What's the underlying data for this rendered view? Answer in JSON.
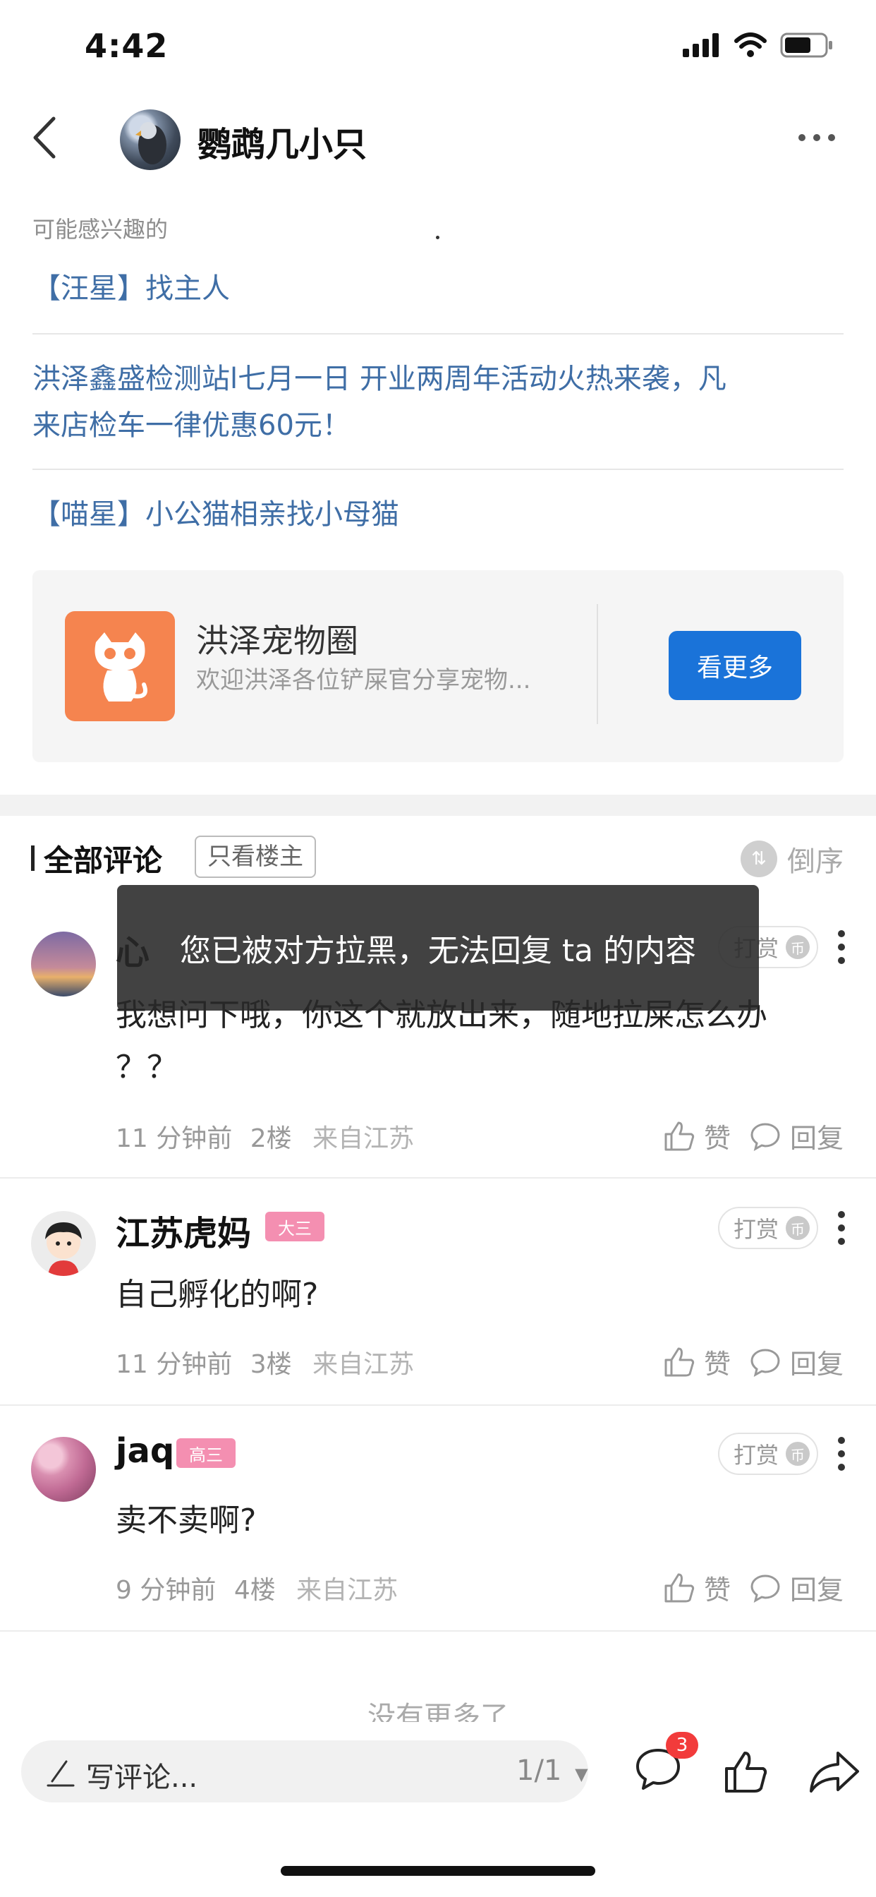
{
  "status_bar": {
    "time": "4:42"
  },
  "nav": {
    "title": "鹦鹉几小只"
  },
  "related": {
    "section_label": "可能感兴趣的",
    "items": [
      {
        "text": "【汪星】找主人"
      },
      {
        "text_line1": "洪泽鑫盛检测站l七月一日 开业两周年活动火热来袭，凡",
        "text_line2": "来店检车一律优惠60元！"
      },
      {
        "text": "【喵星】小公猫相亲找小母猫"
      }
    ]
  },
  "circle_card": {
    "title": "洪泽宠物圈",
    "desc": "欢迎洪泽各位铲屎官分享宠物...",
    "button": "看更多",
    "colors": {
      "logo": "#f5844f",
      "button": "#1a73d9"
    }
  },
  "comments_header": {
    "title": "全部评论",
    "filter": "只看楼主",
    "sort": "倒序"
  },
  "comments": [
    {
      "name": "心",
      "text_line1": "我想问下哦，你这个就放出来，随地拉屎怎么办",
      "text_line2": "？？",
      "time": "11 分钟前",
      "floor": "2楼",
      "location": "来自江苏",
      "tip": "打赏"
    },
    {
      "name": "江苏虎妈",
      "badge": "大三",
      "text": "自己孵化的啊?",
      "time": "11 分钟前",
      "floor": "3楼",
      "location": "来自江苏",
      "tip": "打赏"
    },
    {
      "name": "jaq",
      "badge": "高三",
      "text": "卖不卖啊?",
      "time": "9 分钟前",
      "floor": "4楼",
      "location": "来自江苏",
      "tip": "打赏"
    }
  ],
  "actions": {
    "like": "赞",
    "reply": "回复"
  },
  "toast": "您已被对方拉黑，无法回复 ta 的内容",
  "no_more": "没有更多了",
  "bottom_bar": {
    "input_placeholder": "写评论...",
    "page": "1/1",
    "comment_count": "3"
  },
  "icons": [
    "back-icon",
    "more-icon",
    "sort-icon",
    "coin-icon",
    "like-icon",
    "reply-icon",
    "pen-icon",
    "comment-icon",
    "share-icon"
  ]
}
